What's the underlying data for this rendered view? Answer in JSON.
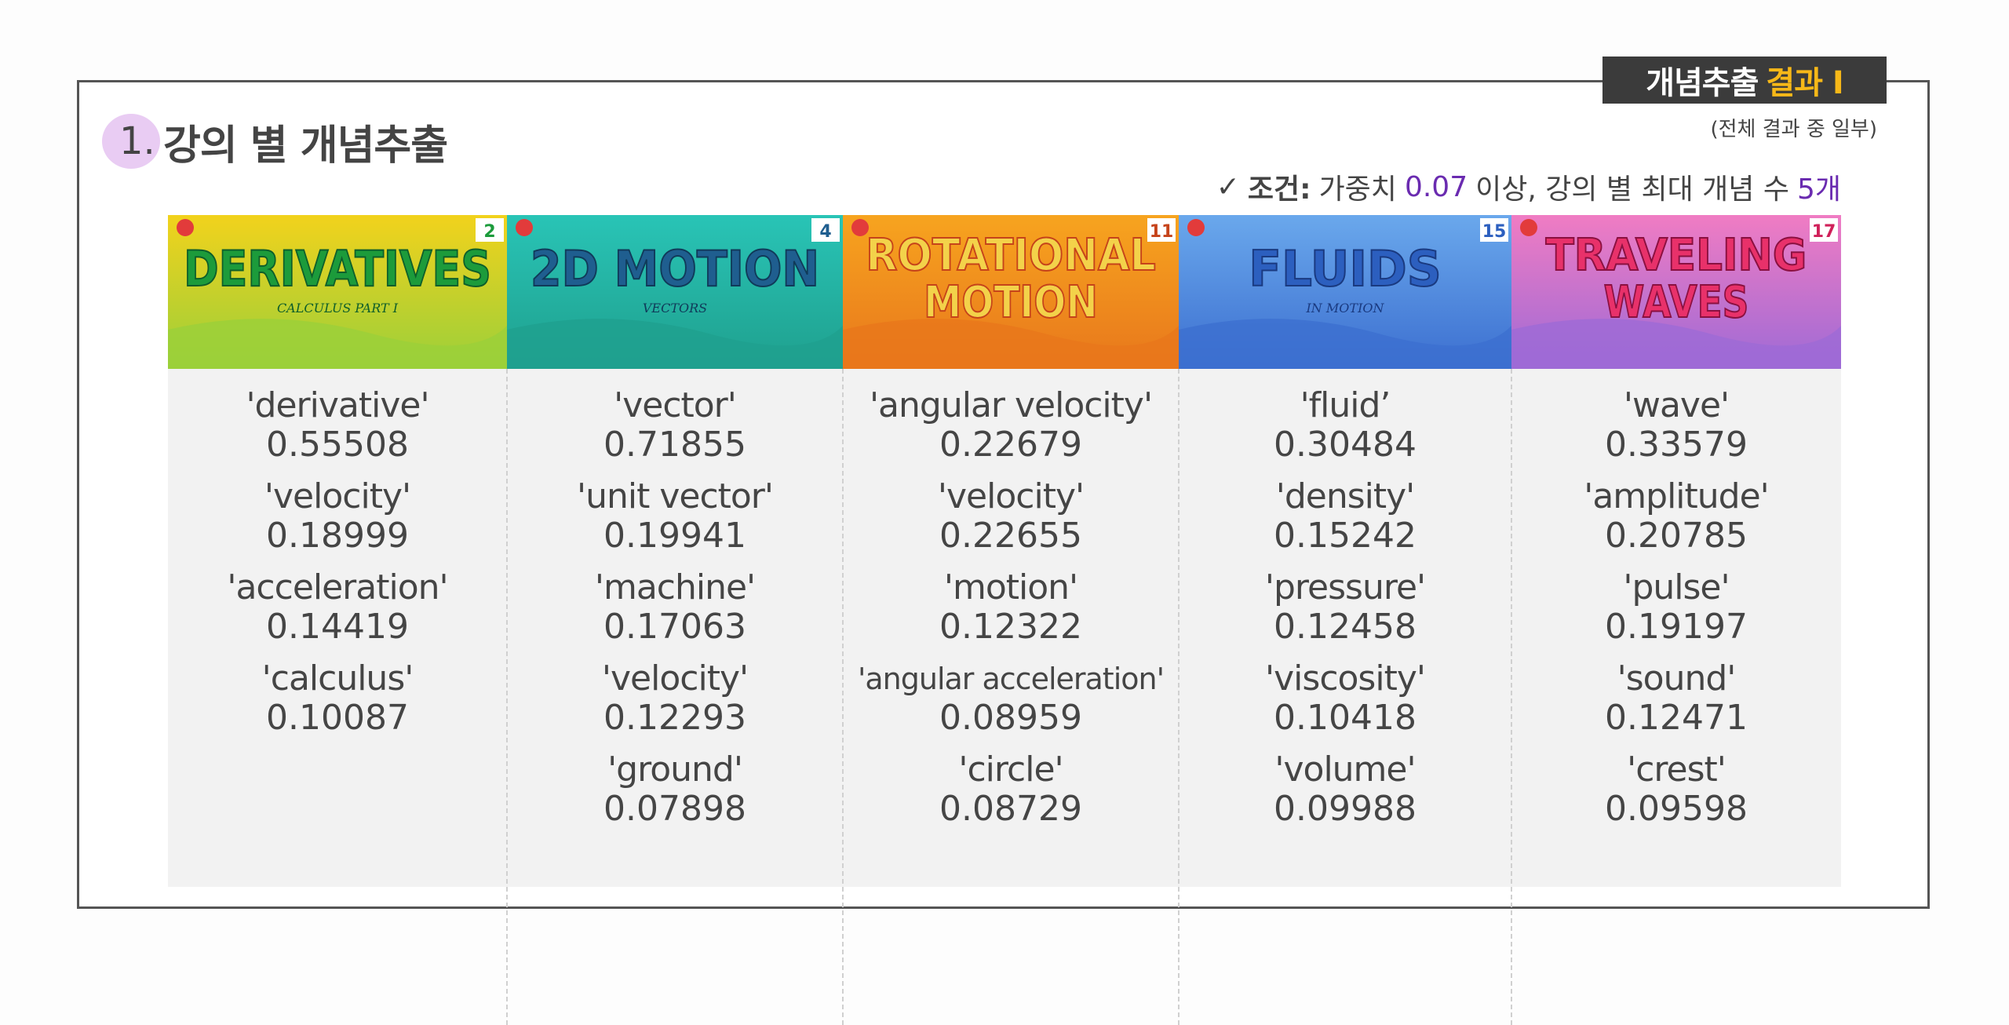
{
  "badge": {
    "text_main": "개념추출",
    "text_highlight": "결과 I"
  },
  "subnote": "(전체 결과 중 일부)",
  "section": {
    "number": "1.",
    "title": "강의 별 개념추출"
  },
  "condition": {
    "check": "✓",
    "label": "조건:",
    "part1": "가중치",
    "weight": "0.07",
    "part2": "이상,  강의 별 최대 개념 수",
    "count": "5개"
  },
  "colors": {
    "accent": "#6a2bb0",
    "badge_highlight": "#f7b818",
    "circle": "#e9ccf3"
  },
  "lectures": [
    {
      "thumb_title": [
        "DERIVATIVES"
      ],
      "thumb_sub": "CALCULUS PART I",
      "episode": "2",
      "concepts": [
        {
          "term": "'derivative'",
          "weight": "0.55508"
        },
        {
          "term": "'velocity'",
          "weight": "0.18999"
        },
        {
          "term": "'acceleration'",
          "weight": "0.14419"
        },
        {
          "term": "'calculus'",
          "weight": "0.10087"
        }
      ]
    },
    {
      "thumb_title": [
        "2D MOTION"
      ],
      "thumb_sub": "VECTORS",
      "episode": "4",
      "concepts": [
        {
          "term": "'vector'",
          "weight": "0.71855"
        },
        {
          "term": "'unit vector'",
          "weight": "0.19941"
        },
        {
          "term": "'machine'",
          "weight": "0.17063"
        },
        {
          "term": "'velocity'",
          "weight": "0.12293"
        },
        {
          "term": "'ground'",
          "weight": "0.07898"
        }
      ]
    },
    {
      "thumb_title": [
        "ROTATIONAL",
        "MOTION"
      ],
      "thumb_sub": "",
      "episode": "11",
      "concepts": [
        {
          "term": "'angular velocity'",
          "weight": "0.22679"
        },
        {
          "term": "'velocity'",
          "weight": "0.22655"
        },
        {
          "term": "'motion'",
          "weight": "0.12322"
        },
        {
          "term": "'angular acceleration'",
          "weight": "0.08959"
        },
        {
          "term": "'circle'",
          "weight": "0.08729"
        }
      ]
    },
    {
      "thumb_title": [
        "FLUIDS"
      ],
      "thumb_sub": "IN MOTION",
      "episode": "15",
      "concepts": [
        {
          "term": "'fluid’",
          "weight": "0.30484"
        },
        {
          "term": "'density'",
          "weight": "0.15242"
        },
        {
          "term": "'pressure'",
          "weight": "0.12458"
        },
        {
          "term": "'viscosity'",
          "weight": "0.10418"
        },
        {
          "term": "'volume'",
          "weight": "0.09988"
        }
      ]
    },
    {
      "thumb_title": [
        "TRAVELING",
        "WAVES"
      ],
      "thumb_sub": "",
      "episode": "17",
      "concepts": [
        {
          "term": "'wave'",
          "weight": "0.33579"
        },
        {
          "term": "'amplitude'",
          "weight": "0.20785"
        },
        {
          "term": "'pulse'",
          "weight": "0.19197"
        },
        {
          "term": "'sound'",
          "weight": "0.12471"
        },
        {
          "term": "'crest'",
          "weight": "0.09598"
        }
      ]
    }
  ]
}
